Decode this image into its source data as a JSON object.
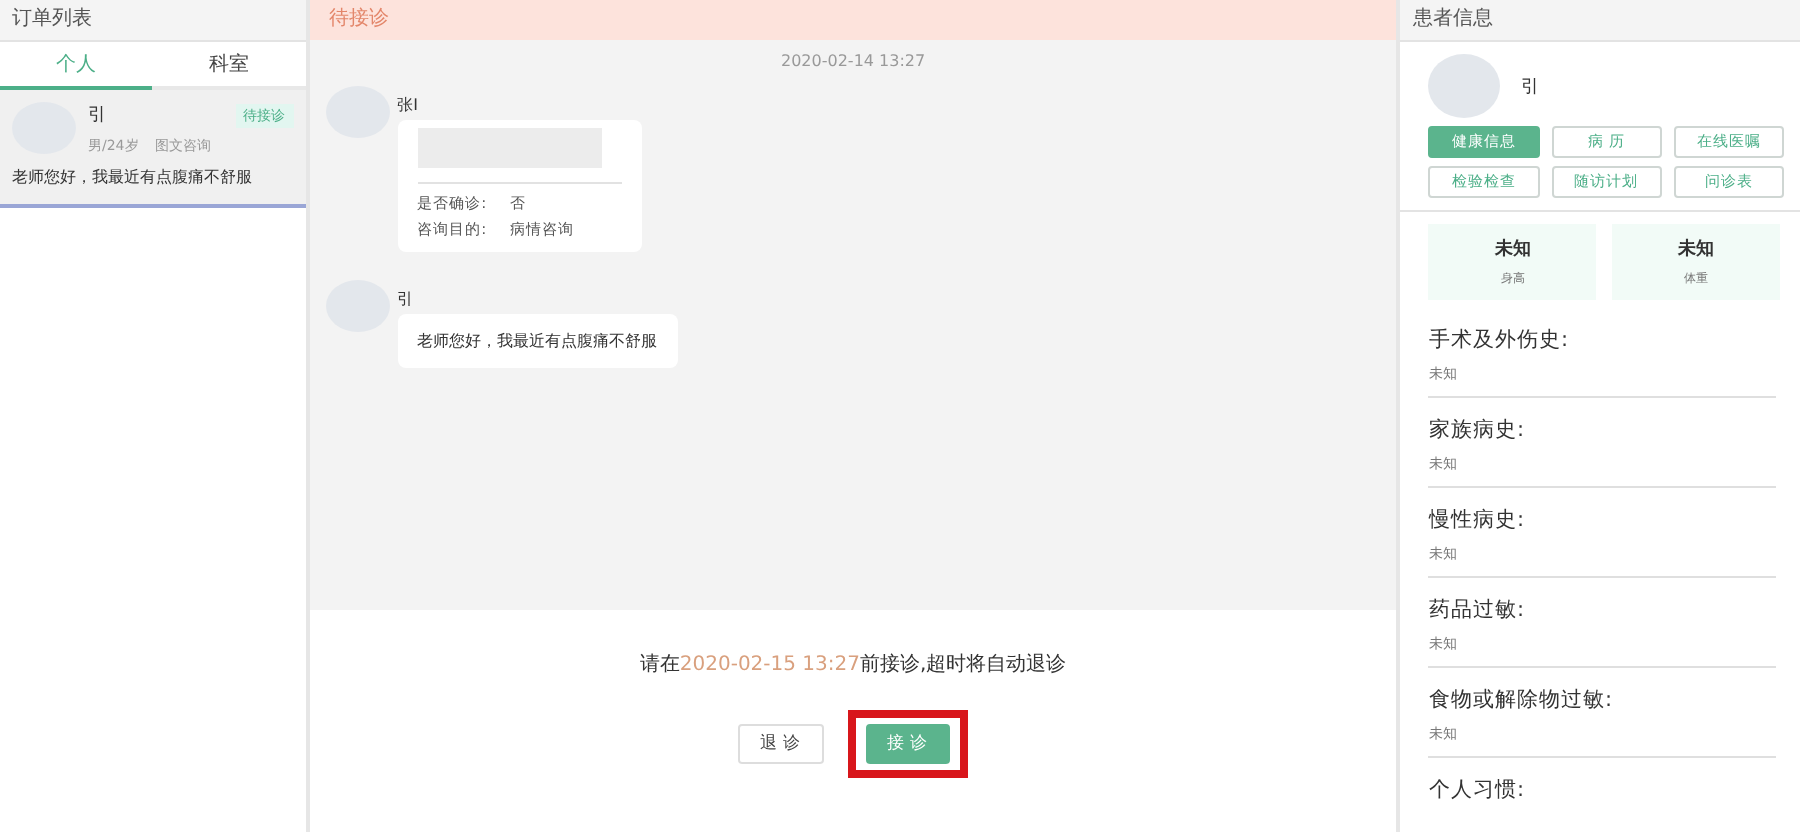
{
  "order_panel": {
    "title": "订单列表",
    "tabs": [
      {
        "label": "个人",
        "selected": true
      },
      {
        "label": "科室",
        "selected": false
      }
    ],
    "orders": [
      {
        "name": "引",
        "status": "待接诊",
        "meta": "男/24岁",
        "type": "图文咨询",
        "message": "老师您好，我最近有点腹痛不舒服",
        "selected": true
      }
    ]
  },
  "chat": {
    "status": "待接诊",
    "timestamp": "2020-02-14 13:27",
    "messages": [
      {
        "kind": "form",
        "sender": "张I",
        "fields": [
          {
            "label": "是否确诊:",
            "value": "否"
          },
          {
            "label": "咨询目的:",
            "value": "病情咨询"
          }
        ]
      },
      {
        "kind": "text",
        "sender": "引",
        "text": "老师您好，我最近有点腹痛不舒服"
      }
    ],
    "notice": {
      "before": "请在",
      "deadline": "2020-02-15 13:27",
      "after": "前接诊,超时将自动退诊"
    },
    "actions": [
      {
        "label": "退 诊",
        "kind": "secondary",
        "highlighted": false
      },
      {
        "label": "接 诊",
        "kind": "primary",
        "highlighted": true
      }
    ]
  },
  "patient_panel": {
    "title": "患者信息",
    "name": "引",
    "buttons": [
      {
        "label": "健康信息",
        "selected": true
      },
      {
        "label": "病 历",
        "selected": false
      },
      {
        "label": "在线医嘱",
        "selected": false
      },
      {
        "label": "检验检查",
        "selected": false
      },
      {
        "label": "随访计划",
        "selected": false
      },
      {
        "label": "问诊表",
        "selected": false
      }
    ],
    "stats": [
      {
        "value": "未知",
        "label": "身高"
      },
      {
        "value": "未知",
        "label": "体重"
      }
    ],
    "history": [
      {
        "title": "手术及外伤史:",
        "value": "未知"
      },
      {
        "title": "家族病史:",
        "value": "未知"
      },
      {
        "title": "慢性病史:",
        "value": "未知"
      },
      {
        "title": "药品过敏:",
        "value": "未知"
      },
      {
        "title": "食物或解除物过敏:",
        "value": "未知"
      },
      {
        "title": "个人习惯:"
      }
    ]
  }
}
